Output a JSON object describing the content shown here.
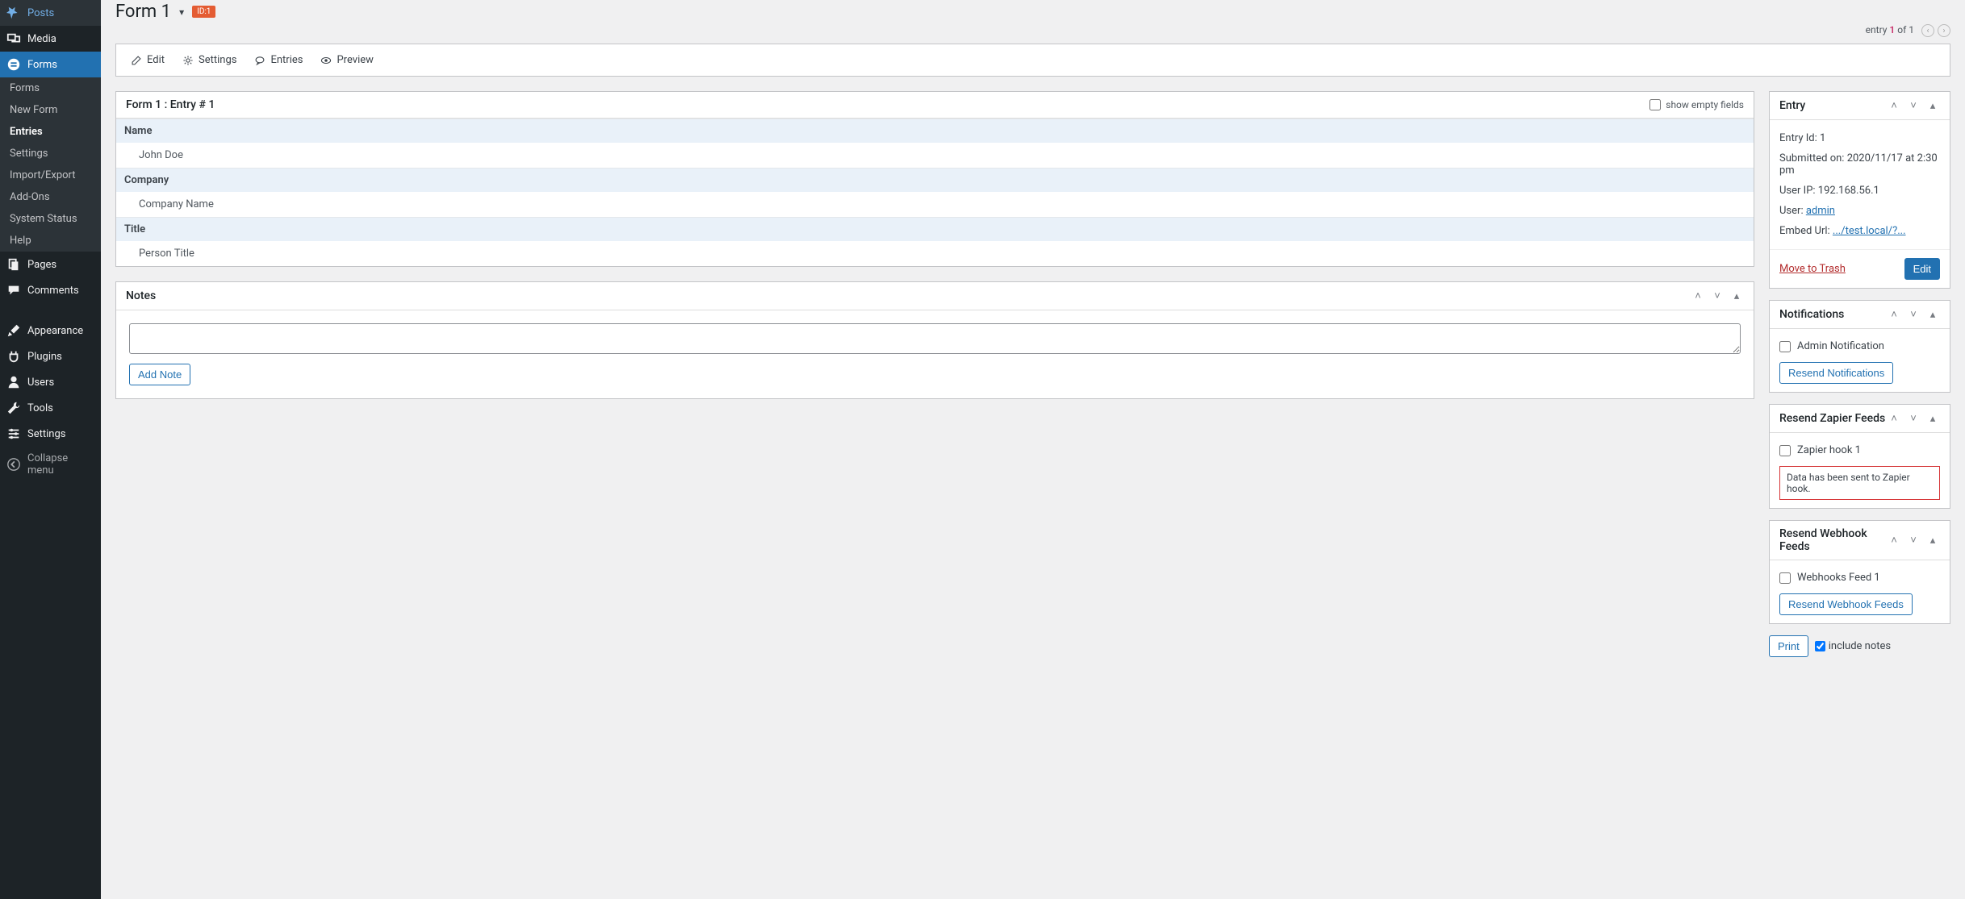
{
  "sidebar": {
    "items": [
      {
        "label": "Posts",
        "icon": "pin"
      },
      {
        "label": "Media",
        "icon": "media"
      },
      {
        "label": "Forms",
        "icon": "forms",
        "active": true
      },
      {
        "label": "Pages",
        "icon": "pages"
      },
      {
        "label": "Comments",
        "icon": "comments"
      },
      {
        "label": "Appearance",
        "icon": "appearance"
      },
      {
        "label": "Plugins",
        "icon": "plugins"
      },
      {
        "label": "Users",
        "icon": "users"
      },
      {
        "label": "Tools",
        "icon": "tools"
      },
      {
        "label": "Settings",
        "icon": "settings"
      },
      {
        "label": "Collapse menu",
        "icon": "collapse"
      }
    ],
    "submenu": [
      {
        "label": "Forms"
      },
      {
        "label": "New Form"
      },
      {
        "label": "Entries",
        "active": true
      },
      {
        "label": "Settings"
      },
      {
        "label": "Import/Export"
      },
      {
        "label": "Add-Ons"
      },
      {
        "label": "System Status"
      },
      {
        "label": "Help"
      }
    ]
  },
  "header": {
    "title": "Form 1",
    "badge": "ID:1"
  },
  "pager": {
    "prefix": "entry",
    "current": "1",
    "of": "of",
    "total": "1"
  },
  "tabs": {
    "edit": "Edit",
    "settings": "Settings",
    "entries": "Entries",
    "preview": "Preview"
  },
  "entry_panel": {
    "title": "Form 1 : Entry # 1",
    "show_empty": "show empty fields",
    "fields": [
      {
        "label": "Name",
        "value": "John Doe"
      },
      {
        "label": "Company",
        "value": "Company Name"
      },
      {
        "label": "Title",
        "value": "Person Title"
      }
    ]
  },
  "notes": {
    "title": "Notes",
    "add_btn": "Add Note"
  },
  "side": {
    "entry": {
      "title": "Entry",
      "id_label": "Entry Id:",
      "id_value": "1",
      "submitted_label": "Submitted on:",
      "submitted_value": "2020/11/17 at 2:30 pm",
      "ip_label": "User IP:",
      "ip_value": "192.168.56.1",
      "user_label": "User:",
      "user_value": "admin",
      "embed_label": "Embed Url:",
      "embed_value": ".../test.local/?...",
      "trash": "Move to Trash",
      "edit": "Edit"
    },
    "notifications": {
      "title": "Notifications",
      "item": "Admin Notification",
      "resend": "Resend Notifications"
    },
    "zapier": {
      "title": "Resend Zapier Feeds",
      "item": "Zapier hook 1",
      "msg": "Data has been sent to Zapier hook."
    },
    "webhook": {
      "title": "Resend Webhook Feeds",
      "item": "Webhooks Feed 1",
      "resend": "Resend Webhook Feeds"
    },
    "print": {
      "btn": "Print",
      "notes": "include notes"
    }
  }
}
